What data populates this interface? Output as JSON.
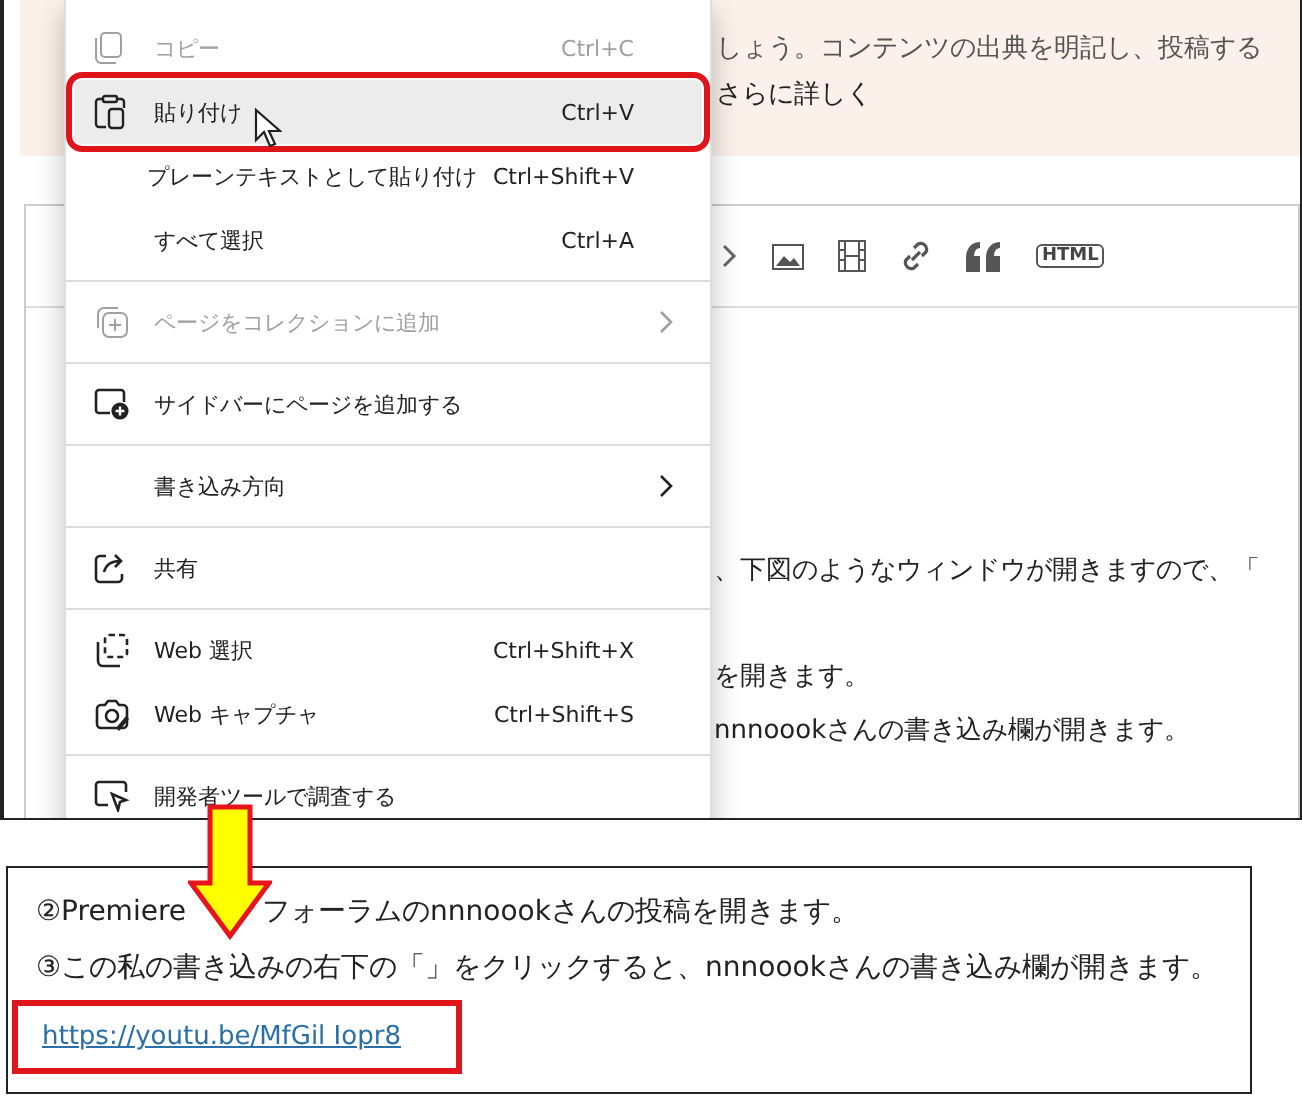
{
  "banner": {
    "lines": [
      "しょう。コンテンツの出典を明記し、投稿する",
      "さらに詳しく"
    ]
  },
  "editor": {
    "toolbar": {
      "html": "HTML"
    },
    "lines": [
      {
        "text": "、下図のようなウィンドウが開きますので、「"
      },
      {
        "text": "を開きます。"
      },
      {
        "text": "nnnoookさんの書き込み欄が開きます。"
      }
    ]
  },
  "context_menu": {
    "groups": [
      [
        {
          "label": "コピー",
          "shortcut": "Ctrl+C",
          "disabled": true,
          "selected": false,
          "marked": false
        },
        {
          "label": "貼り付け",
          "shortcut": "Ctrl+V",
          "disabled": false,
          "selected": true,
          "marked": true
        },
        {
          "label": "プレーンテキストとして貼り付け",
          "shortcut": "Ctrl+Shift+V",
          "disabled": false,
          "selected": false,
          "marked": false
        },
        {
          "label": "すべて選択",
          "shortcut": "Ctrl+A",
          "disabled": false,
          "selected": false,
          "marked": false
        }
      ],
      [
        {
          "label": "ページをコレクションに追加",
          "submenu": true,
          "disabled": true,
          "selected": false,
          "marked": false
        }
      ],
      [
        {
          "label": "サイドバーにページを追加する",
          "disabled": false,
          "selected": false,
          "marked": false
        }
      ],
      [
        {
          "label": "書き込み方向",
          "submenu": true,
          "disabled": false,
          "selected": false,
          "marked": false
        }
      ],
      [
        {
          "label": "共有",
          "disabled": false,
          "selected": false,
          "marked": false
        }
      ],
      [
        {
          "label": "Web 選択",
          "shortcut": "Ctrl+Shift+X",
          "disabled": false,
          "selected": false,
          "marked": false
        },
        {
          "label": "Web キャプチャ",
          "shortcut": "Ctrl+Shift+S",
          "disabled": false,
          "selected": false,
          "marked": false
        }
      ],
      [
        {
          "label": "開発者ツールで調査する",
          "disabled": false,
          "selected": false,
          "marked": false
        }
      ]
    ]
  },
  "result": {
    "line1_start": "②Premiere",
    "line1_end": "フォーラムのnnnoookさんの投稿を開きます。",
    "line2": "③この私の書き込みの右下の「」をクリックすると、nnnoookさんの書き込み欄が開きます。",
    "link": {
      "text": "https://youtu.be/MfGil Iopr8",
      "marked": true
    }
  }
}
